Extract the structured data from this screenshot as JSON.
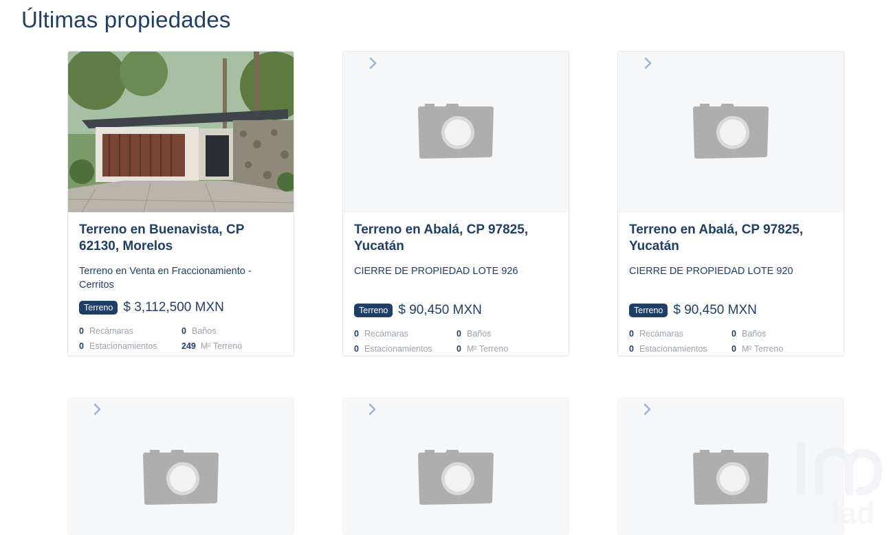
{
  "page": {
    "title": "Últimas propiedades"
  },
  "colors": {
    "brand": "#1f3f66",
    "muted": "#9aa3af",
    "placeholder": "#f6f7f9",
    "chevron": "#9bb4dc"
  },
  "cards": [
    {
      "has_photo": true,
      "title": "Terreno en Buenavista, CP 62130, Morelos",
      "description": "Terreno en Venta en Fraccionamiento - Cerritos",
      "badge": "Terreno",
      "price": "$ 3,112,500 MXN",
      "stats": {
        "bedrooms_num": "0",
        "bedrooms_label": "Recámaras",
        "baths_num": "0",
        "baths_label": "Baños",
        "parking_num": "0",
        "parking_label": "Estacionamientos",
        "land_num": "249",
        "land_label": "M² Terreno"
      }
    },
    {
      "has_photo": false,
      "title": "Terreno en Abalá, CP 97825, Yucatán",
      "description": "CIERRE DE PROPIEDAD LOTE 926",
      "badge": "Terreno",
      "price": "$ 90,450 MXN",
      "stats": {
        "bedrooms_num": "0",
        "bedrooms_label": "Recámaras",
        "baths_num": "0",
        "baths_label": "Baños",
        "parking_num": "0",
        "parking_label": "Estacionamientos",
        "land_num": "0",
        "land_label": "M² Terreno"
      }
    },
    {
      "has_photo": false,
      "title": "Terreno en Abalá, CP 97825, Yucatán",
      "description": "CIERRE DE PROPIEDAD LOTE 920",
      "badge": "Terreno",
      "price": "$ 90,450 MXN",
      "stats": {
        "bedrooms_num": "0",
        "bedrooms_label": "Recámaras",
        "baths_num": "0",
        "baths_label": "Baños",
        "parking_num": "0",
        "parking_label": "Estacionamientos",
        "land_num": "0",
        "land_label": "M² Terreno"
      }
    }
  ],
  "icons": {
    "next": "chevron-right-icon",
    "placeholder": "camera-icon",
    "watermark": "inmuebles24-logo"
  }
}
